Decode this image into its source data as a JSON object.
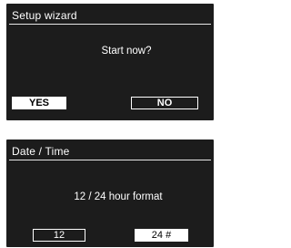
{
  "setup_wizard": {
    "title": "Setup wizard",
    "prompt": "Start now?",
    "yes_label": "YES",
    "no_label": "NO"
  },
  "date_time": {
    "title": "Date / Time",
    "prompt": "12 / 24  hour  format",
    "option_12_label": "12",
    "option_24_label": "24  #"
  },
  "colors": {
    "screen_background": "#1c1c1c",
    "text": "#ffffff",
    "selected_button_background": "#ffffff",
    "selected_button_text": "#000000"
  }
}
